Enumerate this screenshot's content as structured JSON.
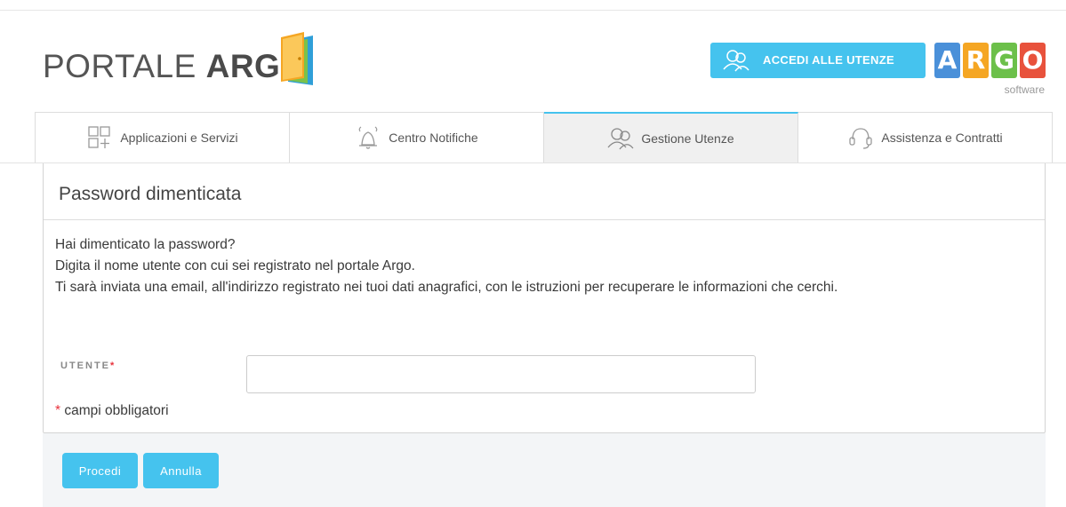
{
  "header": {
    "logo_prefix": "PORTALE",
    "logo_bold": "ARGO",
    "accedi_label": "ACCEDI ALLE UTENZE",
    "argo_letters": [
      "A",
      "R",
      "G",
      "O"
    ],
    "argo_colors": [
      "#4a90d9",
      "#f5a623",
      "#6cc04a",
      "#e8523c"
    ],
    "argo_sub": "software"
  },
  "tabs": [
    {
      "label": "Applicazioni e Servizi",
      "icon": "apps-grid-icon"
    },
    {
      "label": "Centro Notifiche",
      "icon": "bell-icon"
    },
    {
      "label": "Gestione Utenze",
      "icon": "users-icon",
      "active": true
    },
    {
      "label": "Assistenza e Contratti",
      "icon": "headset-icon"
    }
  ],
  "panel": {
    "title": "Password dimenticata",
    "desc_line1": "Hai dimenticato la password?",
    "desc_line2": "Digita il nome utente con cui sei registrato nel portale Argo.",
    "desc_line3": "Ti sarà inviata una email, all'indirizzo registrato nei tuoi dati anagrafici, con le istruzioni per recuperare le informazioni che cerchi.",
    "field_label": "UTENTE",
    "required_mark": "*",
    "field_value": "",
    "required_note": "campi obbligatori"
  },
  "footer": {
    "procedi_label": "Procedi",
    "annulla_label": "Annulla"
  },
  "colors": {
    "accent": "#45c3ee",
    "required": "#e8323c"
  }
}
